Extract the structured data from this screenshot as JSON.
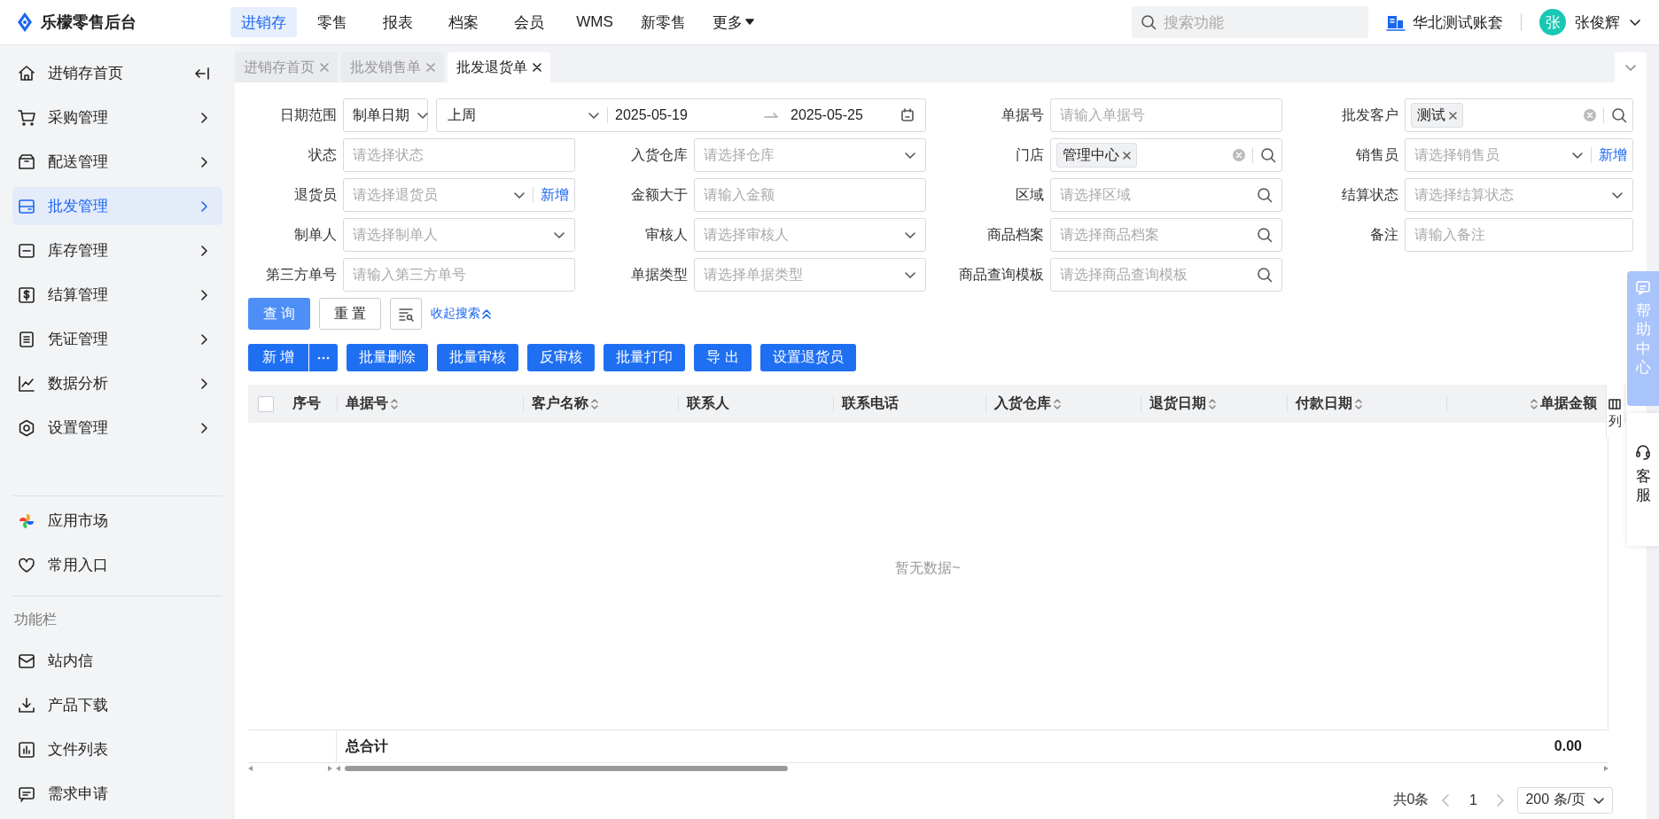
{
  "app": {
    "name": "乐檬零售后台"
  },
  "top_nav": [
    {
      "label": "进销存",
      "selected": true,
      "kind": "link"
    },
    {
      "label": "零售",
      "selected": false,
      "kind": "link"
    },
    {
      "label": "报表",
      "selected": false,
      "kind": "link"
    },
    {
      "label": "档案",
      "selected": false,
      "kind": "link"
    },
    {
      "label": "会员",
      "selected": false,
      "kind": "link"
    },
    {
      "label": "WMS",
      "selected": false,
      "kind": "link"
    },
    {
      "label": "新零售",
      "selected": false,
      "kind": "link"
    },
    {
      "label": "更多",
      "selected": false,
      "kind": "dropdown"
    }
  ],
  "search": {
    "placeholder": "搜索功能"
  },
  "account_set": "华北测试账套",
  "user": {
    "avatar": "张",
    "name": "张俊辉"
  },
  "sidebar": {
    "items": [
      {
        "label": "进销存首页",
        "selected": false,
        "kind": "home"
      },
      {
        "label": "采购管理",
        "selected": false,
        "kind": "group"
      },
      {
        "label": "配送管理",
        "selected": false,
        "kind": "group"
      },
      {
        "label": "批发管理",
        "selected": true,
        "kind": "group"
      },
      {
        "label": "库存管理",
        "selected": false,
        "kind": "group"
      },
      {
        "label": "结算管理",
        "selected": false,
        "kind": "group"
      },
      {
        "label": "凭证管理",
        "selected": false,
        "kind": "group"
      },
      {
        "label": "数据分析",
        "selected": false,
        "kind": "group"
      },
      {
        "label": "设置管理",
        "selected": false,
        "kind": "group"
      }
    ],
    "apps": [
      {
        "label": "应用市场"
      },
      {
        "label": "常用入口"
      }
    ],
    "section_title": "功能栏",
    "tools": [
      {
        "label": "站内信"
      },
      {
        "label": "产品下载"
      },
      {
        "label": "文件列表"
      },
      {
        "label": "需求申请"
      }
    ]
  },
  "tabs": [
    {
      "label": "进销存首页",
      "selected": false
    },
    {
      "label": "批发销售单",
      "selected": false
    },
    {
      "label": "批发退货单",
      "selected": true
    }
  ],
  "filters": [
    {
      "label": "日期范围",
      "kind": "date-range",
      "type": "制单日期",
      "period": "上周",
      "start": "2025-05-19",
      "end": "2025-05-25"
    },
    {
      "label": "单据号",
      "kind": "input",
      "placeholder": "请输入单据号"
    },
    {
      "label": "批发客户",
      "kind": "tags",
      "tags": [
        "测试"
      ]
    },
    {
      "label": "状态",
      "kind": "input",
      "placeholder": "请选择状态"
    },
    {
      "label": "入货仓库",
      "kind": "select",
      "placeholder": "请选择仓库"
    },
    {
      "label": "门店",
      "kind": "tags",
      "tags": [
        "管理中心"
      ]
    },
    {
      "label": "销售员",
      "kind": "select-add",
      "placeholder": "请选择销售员",
      "add": "新增"
    },
    {
      "label": "退货员",
      "kind": "select-add",
      "placeholder": "请选择退货员",
      "add": "新增"
    },
    {
      "label": "金额大于",
      "kind": "input",
      "placeholder": "请输入金额"
    },
    {
      "label": "区域",
      "kind": "search",
      "placeholder": "请选择区域"
    },
    {
      "label": "结算状态",
      "kind": "select",
      "placeholder": "请选择结算状态"
    },
    {
      "label": "制单人",
      "kind": "select",
      "placeholder": "请选择制单人"
    },
    {
      "label": "审核人",
      "kind": "select",
      "placeholder": "请选择审核人"
    },
    {
      "label": "商品档案",
      "kind": "search",
      "placeholder": "请选择商品档案"
    },
    {
      "label": "备注",
      "kind": "input",
      "placeholder": "请输入备注"
    },
    {
      "label": "第三方单号",
      "kind": "input",
      "placeholder": "请输入第三方单号"
    },
    {
      "label": "单据类型",
      "kind": "select",
      "placeholder": "请选择单据类型"
    },
    {
      "label": "商品查询模板",
      "kind": "search",
      "placeholder": "请选择商品查询模板"
    }
  ],
  "filter_buttons": {
    "query": "查 询",
    "reset": "重 置",
    "collapse": "收起搜索"
  },
  "actions": [
    {
      "label": "新 增",
      "kind": "split"
    },
    {
      "label": "批量删除",
      "kind": "button"
    },
    {
      "label": "批量审核",
      "kind": "button"
    },
    {
      "label": "反审核",
      "kind": "button"
    },
    {
      "label": "批量打印",
      "kind": "button"
    },
    {
      "label": "导 出",
      "kind": "button"
    },
    {
      "label": "设置退货员",
      "kind": "button"
    }
  ],
  "table": {
    "select_all": {
      "checked": false
    },
    "columns": [
      {
        "label": "序号",
        "sortable": false,
        "kind": "text"
      },
      {
        "label": "单据号",
        "sortable": true,
        "kind": "text"
      },
      {
        "label": "客户名称",
        "sortable": true,
        "kind": "text"
      },
      {
        "label": "联系人",
        "sortable": false,
        "kind": "text"
      },
      {
        "label": "联系电话",
        "sortable": false,
        "kind": "text"
      },
      {
        "label": "入货仓库",
        "sortable": true,
        "kind": "text"
      },
      {
        "label": "退货日期",
        "sortable": true,
        "kind": "text"
      },
      {
        "label": "付款日期",
        "sortable": true,
        "kind": "text"
      },
      {
        "label": "单据金额",
        "sortable": true,
        "kind": "number"
      }
    ],
    "column_settings": "列",
    "empty_text": "暂无数据~",
    "footer": {
      "label": "总合计",
      "amount": "0.00"
    }
  },
  "pagination": {
    "total": "共0条",
    "pages": [
      {
        "label": "1",
        "selected": true
      }
    ],
    "page_size": "200 条/页"
  },
  "help": {
    "help_center": "帮助中心",
    "customer_service": "客服"
  }
}
